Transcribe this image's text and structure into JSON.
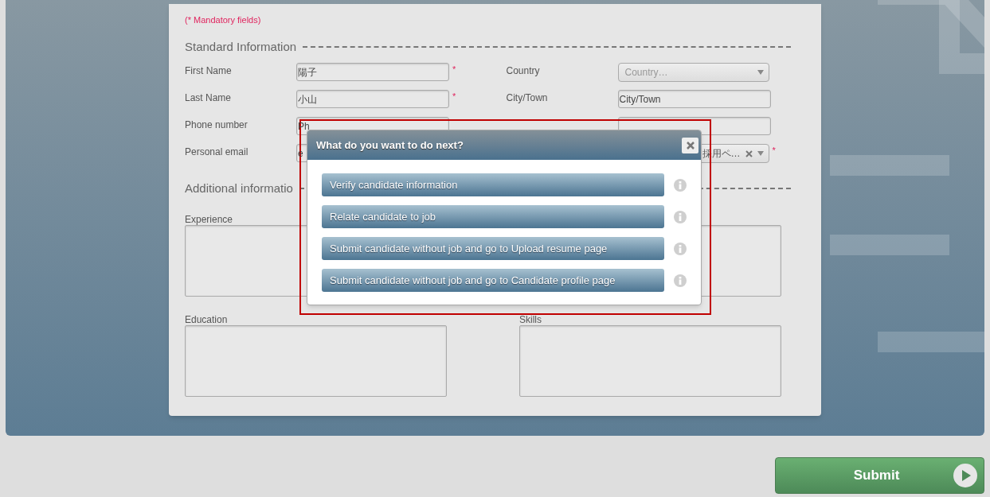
{
  "mandatory_note": "(* Mandatory fields)",
  "standard_section": {
    "title": "Standard Information",
    "left_fields": [
      {
        "label": "First Name",
        "value": "陽子",
        "kind": "text",
        "required_mark": "*"
      },
      {
        "label": "Last Name",
        "value": "小山",
        "kind": "text",
        "required_mark": "*"
      },
      {
        "label": "Phone number",
        "value": "Ph",
        "kind": "text"
      },
      {
        "label": "Personal email",
        "value": "e",
        "kind": "text"
      }
    ],
    "right_fields": [
      {
        "label": "Country",
        "placeholder": "Country…",
        "kind": "select"
      },
      {
        "label": "City/Town",
        "value": "City/Town",
        "kind": "text"
      },
      {
        "kind": "text"
      },
      {
        "value": "採用ペ…",
        "kind": "select",
        "clearable": true,
        "required_mark": "*"
      }
    ]
  },
  "additional_section": {
    "title": "Additional informatio",
    "areas": [
      {
        "label": "Experience",
        "kind": "textarea"
      },
      {
        "kind": "textarea"
      },
      {
        "label": "Education",
        "kind": "textarea"
      },
      {
        "label": "Skills",
        "kind": "textarea"
      }
    ]
  },
  "dialog": {
    "title": "What do you want to do next?",
    "options": [
      {
        "label": "Verify candidate information"
      },
      {
        "label": "Relate candidate to job"
      },
      {
        "label": "Submit candidate without job and go to Upload resume page"
      },
      {
        "label": "Submit candidate without job and go to Candidate profile page"
      }
    ]
  },
  "submit_button": "Submit"
}
